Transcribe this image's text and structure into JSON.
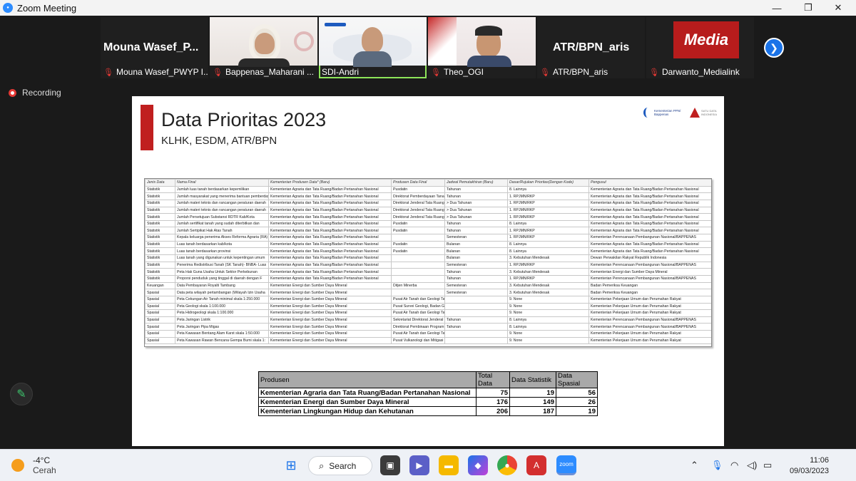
{
  "window": {
    "title": "Zoom Meeting",
    "app_icon": "zoom-icon"
  },
  "participants": [
    {
      "big_name": "Mouna  Wasef_P...",
      "label": "Mouna Wasef_PWYP I...",
      "muted": true,
      "video": false
    },
    {
      "big_name": "",
      "label": "Bappenas_Maharani ...",
      "muted": true,
      "video": true
    },
    {
      "big_name": "",
      "label": "SDI-Andri",
      "muted": false,
      "video": true,
      "active": true
    },
    {
      "big_name": "",
      "label": "Theo_OGI",
      "muted": true,
      "video": true
    },
    {
      "big_name": "ATR/BPN_aris",
      "label": "ATR/BPN_aris",
      "muted": true,
      "video": false
    },
    {
      "big_name": "",
      "label": "Darwanto_Medialink",
      "muted": true,
      "video": true
    }
  ],
  "media_logo_text": "Media",
  "recording_label": "Recording",
  "slide": {
    "title": "Data Prioritas 2023",
    "subtitle": "KLHK, ESDM, ATR/BPN",
    "logo1_text_1": "Kementerian PPN/",
    "logo1_text_2": "Bappenas",
    "logo2_text_1": "SATU DATA",
    "logo2_text_2": "INDONESIA",
    "table_headers": [
      "Jenis Data",
      "Nama Final",
      "Kementerian Produsen Data* (Baru)",
      "Produsen Data Final",
      "Jadwal Pemutakhiran (Baru)",
      "Dasar/Rujukan Prioritas(Dengan Kode)",
      "Pengusul"
    ],
    "table_rows": [
      [
        "Statistik",
        "Jumlah luas tanah berdasarkan kepemilikan",
        "Kementerian Agraria dan Tata Ruang/Badan Pertanahan Nasional",
        "Pusdatin",
        "Tahunan",
        "8. Lainnya",
        "Kementerian Agraria dan Tata Ruang/Badan Pertanahan Nasional"
      ],
      [
        "Statistik",
        "Jumlah masyarakat yang menerima bantuan pemberdayaan",
        "Kementerian Agraria dan Tata Ruang/Badan Pertanahan Nasional",
        "Direktorat Pemberdayaan Tanah",
        "Tahunan",
        "1. RPJMN/RKP",
        "Kementerian Agraria dan Tata Ruang/Badan Pertanahan Nasional"
      ],
      [
        "Statistik",
        "Jumlah materi teknis dan rancangan peraturan daerah",
        "Kementerian Agraria dan Tata Ruang/Badan Pertanahan Nasional",
        "Direktorat Jenderal Tata Ruang",
        "> Dua Tahunan",
        "1. RPJMN/RKP",
        "Kementerian Agraria dan Tata Ruang/Badan Pertanahan Nasional"
      ],
      [
        "Statistik",
        "Jumlah materi teknis dan rancangan peraturan daerah",
        "Kementerian Agraria dan Tata Ruang/Badan Pertanahan Nasional",
        "Direktorat Jenderal Tata Ruang",
        "> Dua Tahunan",
        "1. RPJMN/RKP",
        "Kementerian Agraria dan Tata Ruang/Badan Pertanahan Nasional"
      ],
      [
        "Statistik",
        "Jumlah Persetujuan Substansi RDTR Kab/Kota",
        "Kementerian Agraria dan Tata Ruang/Badan Pertanahan Nasional",
        "Direktorat Jenderal Tata Ruang",
        "> Dua Tahunan",
        "1. RPJMN/RKP",
        "Kementerian Agraria dan Tata Ruang/Badan Pertanahan Nasional"
      ],
      [
        "Statistik",
        "Jumlah sertifikat tanah yang sudah diterbitkan dan",
        "Kementerian Agraria dan Tata Ruang/Badan Pertanahan Nasional",
        "Pusdatin",
        "Tahunan",
        "8. Lainnya",
        "Kementerian Agraria dan Tata Ruang/Badan Pertanahan Nasional"
      ],
      [
        "Statistik",
        "Jumlah Sertipikat Hak Atas Tanah",
        "Kementerian Agraria dan Tata Ruang/Badan Pertanahan Nasional",
        "Pusdatin",
        "Tahunan",
        "1. RPJMN/RKP",
        "Kementerian Agraria dan Tata Ruang/Badan Pertanahan Nasional"
      ],
      [
        "Statistik",
        "Kepala keluarga penerima Akses Reforma Agraria (RA)",
        "Kementerian Agraria dan Tata Ruang/Badan Pertanahan Nasional",
        "",
        "Semesteran",
        "1. RPJMN/RKP",
        "Kementerian Perencanaan Pembangunan Nasional/BAPPENAS"
      ],
      [
        "Statistik",
        "Luas tanah berdasarkan kab/kota",
        "Kementerian Agraria dan Tata Ruang/Badan Pertanahan Nasional",
        "Pusdatin",
        "Bulanan",
        "8. Lainnya",
        "Kementerian Agraria dan Tata Ruang/Badan Pertanahan Nasional"
      ],
      [
        "Statistik",
        "Luas tanah berdasarkan provinsi",
        "Kementerian Agraria dan Tata Ruang/Badan Pertanahan Nasional",
        "Pusdatin",
        "Bulanan",
        "8. Lainnya",
        "Kementerian Agraria dan Tata Ruang/Badan Pertanahan Nasional"
      ],
      [
        "Statistik",
        "Luas tanah yang digunakan untuk kepentingan umum",
        "Kementerian Agraria dan Tata Ruang/Badan Pertanahan Nasional",
        "",
        "Bulanan",
        "3. Kebutuhan Mendesak",
        "Dewan Perwakilan Rakyat Republik Indonesia"
      ],
      [
        "Statistik",
        "Penerima Redistribusi Tanah (SK Tanah)- BNBA- Luas",
        "Kementerian Agraria dan Tata Ruang/Badan Pertanahan Nasional",
        "",
        "Semesteran",
        "1. RPJMN/RKP",
        "Kementerian Perencanaan Pembangunan Nasional/BAPPENAS"
      ],
      [
        "Statistik",
        "Peta Hak Guna Usaha Untuk Sektor Perkebunan",
        "Kementerian Agraria dan Tata Ruang/Badan Pertanahan Nasional",
        "",
        "Tahunan",
        "3. Kebutuhan Mendesak",
        "Kementerian Energi dan Sumber Daya Mineral"
      ],
      [
        "Statistik",
        "Proporsi penduduk yang tinggal di daerah dengan F",
        "Kementerian Agraria dan Tata Ruang/Badan Pertanahan Nasional",
        "",
        "Tahunan",
        "1. RPJMN/RKP",
        "Kementerian Perencanaan Pembangunan Nasional/BAPPENAS"
      ],
      [
        "Keuangan",
        "Data Pembayaran Royalti Tambang",
        "Kementerian Energi dan Sumber Daya Mineral",
        "Ditjen Minerba",
        "Semesteran",
        "3. Kebutuhan Mendesak",
        "Badan Pemeriksa Keuangan"
      ],
      [
        "Spasial",
        "Data peta wilayah pertambangan (Wilayah Izin Usaha",
        "Kementerian Energi dan Sumber Daya Mineral",
        "",
        "Semesteran",
        "3. Kebutuhan Mendesak",
        "Badan Pemeriksa Keuangan"
      ],
      [
        "Spasial",
        "Peta Cekungan Air Tanah minimal skala 1:250.000",
        "Kementerian Energi dan Sumber Daya Mineral",
        "Pusat Air Tanah dan Geologi Tata Lingkungan, Badan Geologi, Ke",
        "",
        "9. None",
        "Kementerian Pekerjaan Umum dan Perumahan Rakyat"
      ],
      [
        "Spasial",
        "Peta Geologi skala 1:100.000",
        "Kementerian Energi dan Sumber Daya Mineral",
        "Pusat Survei Geologi, Badan Geologi",
        "",
        "9. None",
        "Kementerian Pekerjaan Umum dan Perumahan Rakyat"
      ],
      [
        "Spasial",
        "Peta Hidrogeologi skala 1:100.000",
        "Kementerian Energi dan Sumber Daya Mineral",
        "Pusat Air Tanah dan Geologi Tata Lingkungan, Badan Geologi, Ke",
        "",
        "9. None",
        "Kementerian Pekerjaan Umum dan Perumahan Rakyat"
      ],
      [
        "Spasial",
        "Peta Jaringan Listrik",
        "Kementerian Energi dan Sumber Daya Mineral",
        "Sekretariat Direktorat Jenderal",
        "Tahunan",
        "8. Lainnya",
        "Kementerian Perencanaan Pembangunan Nasional/BAPPENAS"
      ],
      [
        "Spasial",
        "Peta Jaringan Pipa Migas",
        "Kementerian Energi dan Sumber Daya Mineral",
        "Direktorat Pembinaan Program",
        "Tahunan",
        "8. Lainnya",
        "Kementerian Perencanaan Pembangunan Nasional/BAPPENAS"
      ],
      [
        "Spasial",
        "Peta Kawasan Bentang Alam Karst skala 1:50.000",
        "Kementerian Energi dan Sumber Daya Mineral",
        "Pusat Air Tanah dan Geologi Tata Lingkungan, Badan Geologi, Ke",
        "",
        "9. None",
        "Kementerian Pekerjaan Umum dan Perumahan Rakyat"
      ],
      [
        "Spasial",
        "Peta Kawasan Rawan Bencana Gempa Bumi skala 1:",
        "Kementerian Energi dan Sumber Daya Mineral",
        "Pusat Vulkanologi dan Mitigasi Bencana Geologi, Badan Geologi",
        "",
        "9. None",
        "Kementerian Pekerjaan Umum dan Perumahan Rakyat"
      ]
    ],
    "summary_headers": [
      "Produsen",
      "Total Data",
      "Data Statistik",
      "Data Spasial"
    ],
    "summary_rows": [
      [
        "Kementerian Agraria dan Tata Ruang/Badan Pertanahan Nasional",
        "75",
        "19",
        "56"
      ],
      [
        "Kementerian Energi dan Sumber Daya Mineral",
        "176",
        "149",
        "26"
      ],
      [
        "Kementerian Lingkungan Hidup dan Kehutanan",
        "206",
        "187",
        "19"
      ]
    ]
  },
  "taskbar": {
    "temperature": "-4°C",
    "condition": "Cerah",
    "search_label": "Search",
    "zoom_label": "zoom",
    "time": "11:06",
    "date": "09/03/2023",
    "pinned_icons": [
      "windows-start-icon",
      "task-view-icon",
      "chat-icon",
      "file-explorer-icon",
      "copilot-icon",
      "chrome-icon",
      "acrobat-icon",
      "zoom-icon"
    ],
    "tray_icons": [
      "chevron-up-icon",
      "microphone-icon",
      "wifi-icon",
      "volume-icon",
      "battery-icon"
    ]
  },
  "colors": {
    "active_speaker": "#8ee65a",
    "accent": "#2d8cff",
    "slide_bar": "#c01f1f"
  }
}
